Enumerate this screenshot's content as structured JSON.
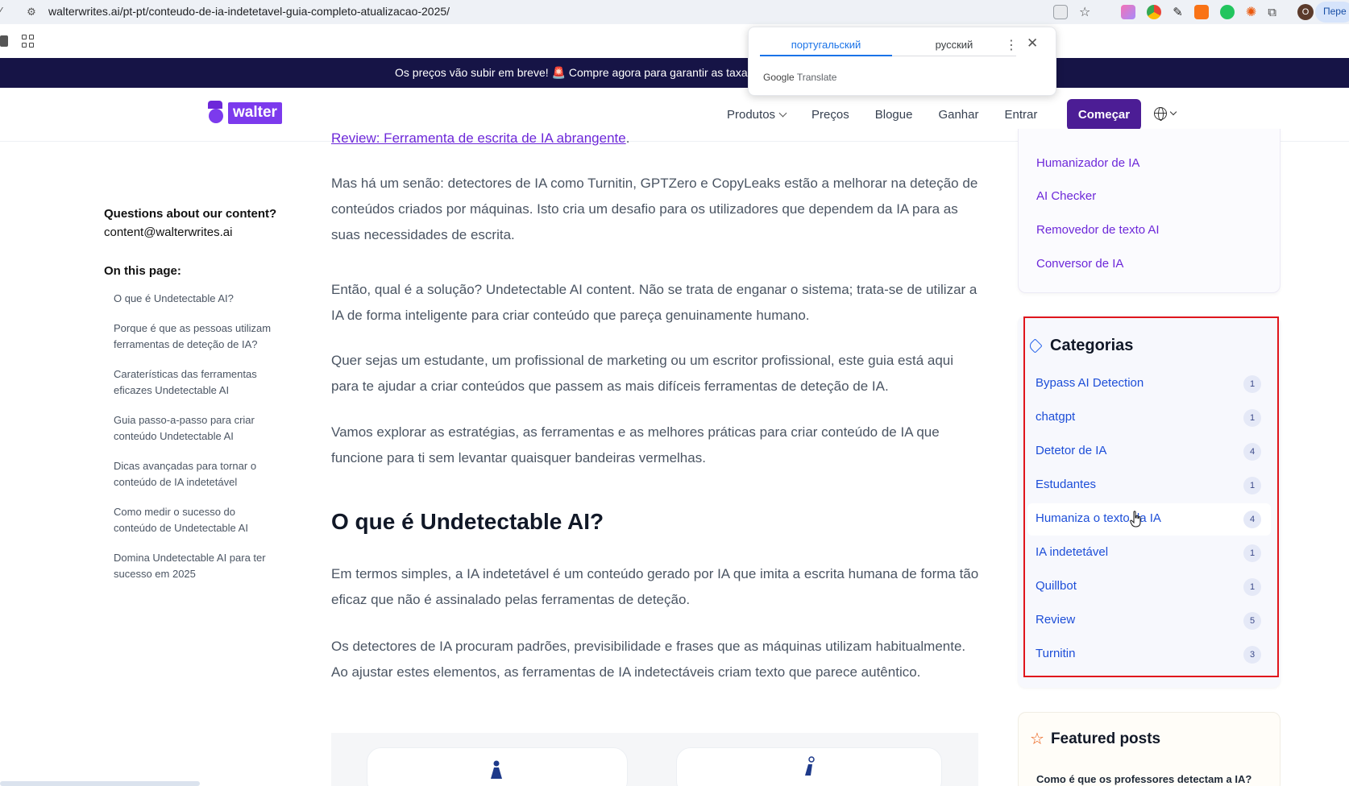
{
  "browser": {
    "url": "walterwrites.ai/pt-pt/conteudo-de-ia-indetetavel-guia-completo-atualizacao-2025/",
    "profile_initial": "O",
    "translate_pill": "Пере"
  },
  "translate_popup": {
    "tab_source": "португальский",
    "tab_target": "русский",
    "brand": "Google",
    "brand_suffix": "Translate"
  },
  "announcement": {
    "text": "Os preços vão subir em breve! 🚨 Compre agora para garantir as taxas"
  },
  "header": {
    "logo_text": "walter",
    "nav": [
      "Produtos",
      "Preços",
      "Blogue",
      "Ganhar",
      "Entrar"
    ],
    "cta": "Começar"
  },
  "toc": {
    "questions_title": "Questions about our content?",
    "questions_email": "content@walterwrites.ai",
    "on_this_page": "On this page:",
    "items": [
      "O que é Undetectable AI?",
      "Porque é que as pessoas utilizam ferramentas de deteção de IA?",
      "Caraterísticas das ferramentas eficazes Undetectable AI",
      "Guia passo-a-passo para criar conteúdo Undetectable AI",
      "Dicas avançadas para tornar o conteúdo de IA indetetável",
      "Como medir o sucesso do conteúdo de Undetectable AI",
      "Domina Undetectable AI para ter sucesso em 2025"
    ]
  },
  "article": {
    "top_link": "Review: Ferramenta de escrita de IA abrangente",
    "top_link_suffix": ".",
    "p1": "Mas há um senão: detectores de IA como Turnitin, GPTZero e CopyLeaks estão a melhorar na deteção de conteúdos criados por máquinas. Isto cria um desafio para os utilizadores que dependem da IA para as suas necessidades de escrita.",
    "p2": "Então, qual é a solução? Undetectable AI content. Não se trata de enganar o sistema; trata-se de utilizar a IA de forma inteligente para criar conteúdo que pareça genuinamente humano.",
    "p3": "Quer sejas um estudante, um profissional de marketing ou um escritor profissional, este guia está aqui para te ajudar a criar conteúdos que passem as mais difíceis ferramentas de deteção de IA.",
    "p4": "Vamos explorar as estratégias, as ferramentas e as melhores práticas para criar conteúdo de IA que funcione para ti sem levantar quaisquer bandeiras vermelhas.",
    "h2": "O que é Undetectable AI?",
    "p5": "Em termos simples, a IA indetetável é um conteúdo gerado por IA que imita a escrita humana de forma tão eficaz que não é assinalado pelas ferramentas de deteção.",
    "p6": "Os detectores de IA procuram padrões, previsibilidade e frases que as máquinas utilizam habitualmente. Ao ajustar estes elementos, as ferramentas de IA indetectáveis criam texto que parece autêntico."
  },
  "sidebar": {
    "tool_links": [
      "Humanizador de IA",
      "AI Checker",
      "Removedor de texto AI",
      "Conversor de IA"
    ],
    "categories_title": "Categorias",
    "categories": [
      {
        "label": "Bypass AI Detection",
        "count": "1"
      },
      {
        "label": "chatgpt",
        "count": "1"
      },
      {
        "label": "Detetor de IA",
        "count": "4"
      },
      {
        "label": "Estudantes",
        "count": "1"
      },
      {
        "label": "Humaniza o texto da IA",
        "count": "4"
      },
      {
        "label": "IA indetetável",
        "count": "1"
      },
      {
        "label": "Quillbot",
        "count": "1"
      },
      {
        "label": "Review",
        "count": "5"
      },
      {
        "label": "Turnitin",
        "count": "3"
      }
    ],
    "featured_title": "Featured posts",
    "featured_first": "Como é que os professores detectam a IA?"
  },
  "colors": {
    "brand": "#7c3aed",
    "cta": "#4c1d95",
    "announce_bg": "#161446",
    "highlight_border": "#e0161c"
  }
}
